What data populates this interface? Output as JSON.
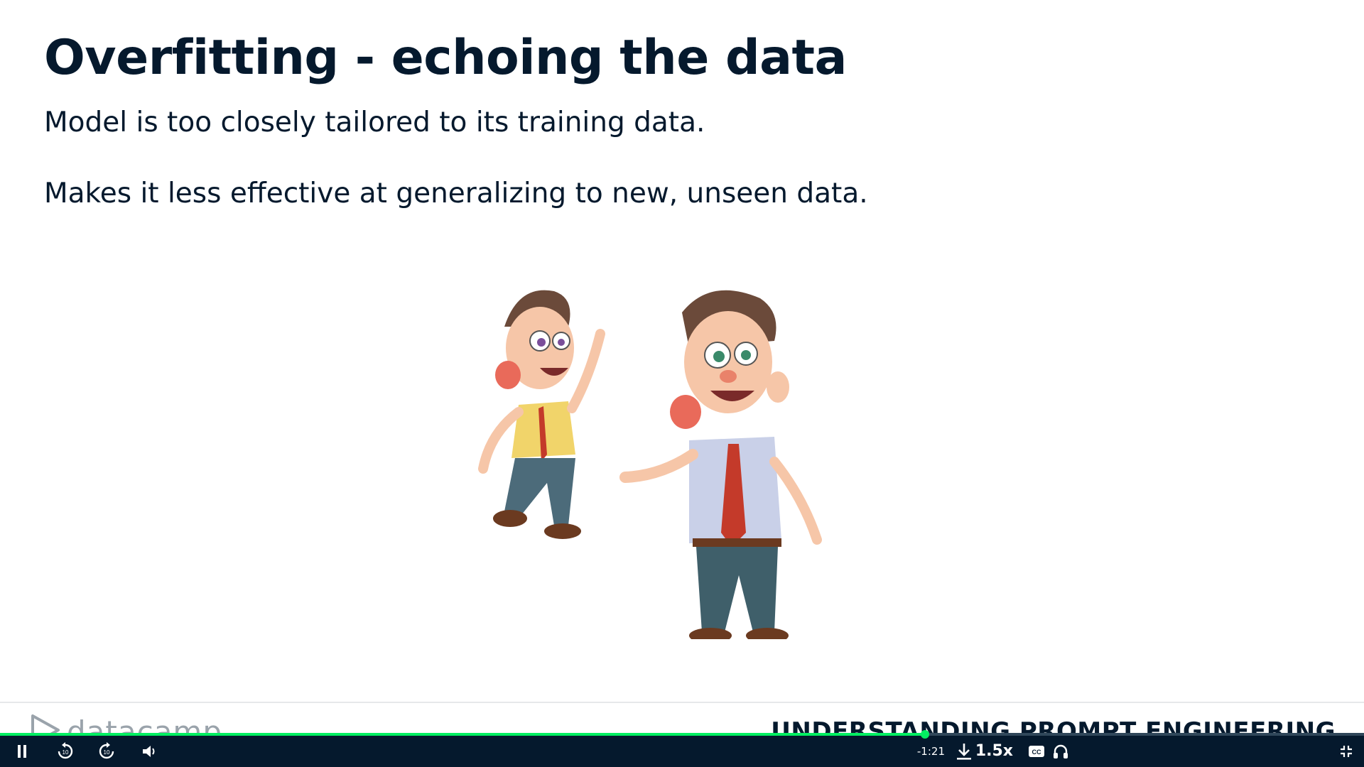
{
  "slide": {
    "title": "Overfitting - echoing the data",
    "bullets": [
      "Model is too closely tailored to its training data.",
      "Makes it less effective at generalizing to new, unseen data."
    ],
    "illustration": "two-cartoon-men-mimicking"
  },
  "footer": {
    "brand": "datacamp",
    "course_title": "UNDERSTANDING PROMPT ENGINEERING"
  },
  "player": {
    "progress_fraction": 0.678,
    "time_remaining": "-1:21",
    "speed": "1.5x",
    "accent_color": "#03ef62",
    "bar_color": "#05192d",
    "icons": [
      "pause-icon",
      "rewind-10-icon",
      "forward-10-icon",
      "volume-icon",
      "download-icon",
      "captions-icon",
      "headphones-icon",
      "exit-fullscreen-icon"
    ]
  }
}
